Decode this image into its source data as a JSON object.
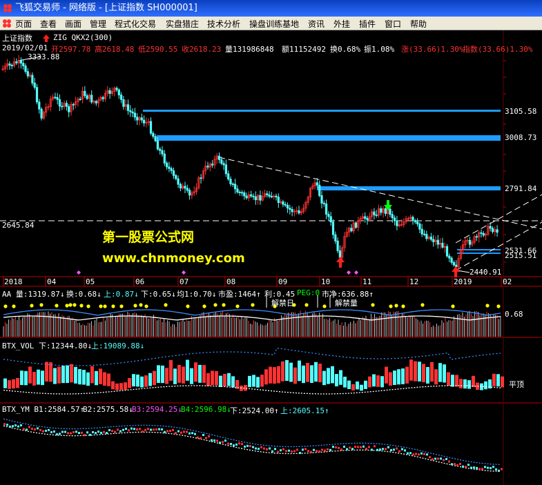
{
  "window": {
    "title": "飞狐交易师 - 网络版 - [上证指数 SH000001]"
  },
  "menu": [
    "页面",
    "查看",
    "画面",
    "管理",
    "程式化交易",
    "实盘猎庄",
    "技术分析",
    "操盘训练基地",
    "资讯",
    "外挂",
    "插件",
    "窗口",
    "帮助"
  ],
  "main_header": {
    "name": "上证指数",
    "indicator": "ZIG QKX2(300)",
    "date": "2019/02/01",
    "open": "开2597.78",
    "high": "高2618.48",
    "low": "低2590.55",
    "close": "收2618.23",
    "volume": "量131986848",
    "amount": "额11152492",
    "turnover": "换0.68%",
    "amplitude": "振1.08%",
    "change": "涨(33.66)1.30%",
    "index_change": "指数(33.66)1.30%"
  },
  "price_levels": {
    "top": "3333.88",
    "l1": "3105.58",
    "l2": "3008.73",
    "l3": "2791.84",
    "cur": "2645.84",
    "l4": "2531.66",
    "l5": "2515.51",
    "bottom": "2440.91"
  },
  "watermark": {
    "line1": "第一股票公式网",
    "line2": "www.chnmoney.com"
  },
  "time_axis": [
    "2018",
    "04",
    "05",
    "06",
    "07",
    "08",
    "09",
    "10",
    "11",
    "12",
    "2019",
    "02"
  ],
  "panel_aa": {
    "items": [
      "AA 量:1319.87↓",
      "换:0.68↓",
      "上:0.87↓",
      "下:0.65↓",
      "均1:0.70↓",
      "市盈:1464↑",
      "利:0.45",
      "PEG:0",
      "市净:636.88↑"
    ],
    "label_a": "解禁日",
    "label_b": "解禁量",
    "value": "0.68"
  },
  "panel_vol": {
    "items": [
      "BTX_VOL 下:12344.80↓",
      "上:19089.88↓"
    ],
    "label": "平顶"
  },
  "panel_ym": {
    "items": [
      "BTX_YM B1:2584.57↑",
      "B2:2575.58↓",
      "B3:2594.25↓",
      "B4:2596.98↓",
      "下:2524.00↑",
      "上:2605.15↑"
    ]
  },
  "colors": {
    "up": "#ff3232",
    "down": "#54ffff",
    "level": "#1e9cff",
    "ma": "#3c8cff",
    "yellow": "#ffff00",
    "magenta": "#ff54ff",
    "green": "#00ff00"
  }
}
